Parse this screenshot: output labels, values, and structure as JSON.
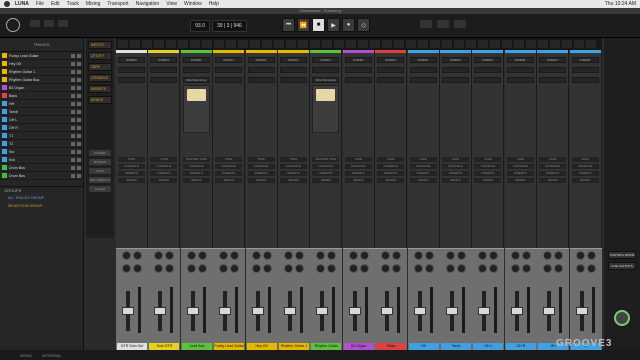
{
  "menubar": {
    "app_name": "LUNA",
    "items": [
      "File",
      "Edit",
      "Track",
      "Mixing",
      "Transport",
      "Navigation",
      "View",
      "Window",
      "Help"
    ],
    "clock": "Thu 10:24 AM"
  },
  "window_title": "Chaosmack - Summing",
  "transport": {
    "tempo": "93.0",
    "position": "39 | 3 | 946"
  },
  "left_panel": {
    "header": "TRACKS",
    "tracks": [
      {
        "name": "Funky Lead Guitar",
        "color": "#e6b800"
      },
      {
        "name": "Hey Oh",
        "color": "#e6b800"
      },
      {
        "name": "Rhythm Guitar 1",
        "color": "#e6b800"
      },
      {
        "name": "Rhythm Guitar Bus",
        "color": "#e6b800"
      },
      {
        "name": "B3 Organ",
        "color": "#b050d0"
      },
      {
        "name": "Bass",
        "color": "#e04040"
      },
      {
        "name": "HH",
        "color": "#40a0e0"
      },
      {
        "name": "Tamb",
        "color": "#40a0e0"
      },
      {
        "name": "OH L",
        "color": "#40a0e0"
      },
      {
        "name": "OH R",
        "color": "#40a0e0"
      },
      {
        "name": "T1",
        "color": "#40a0e0"
      },
      {
        "name": "T2",
        "color": "#40a0e0"
      },
      {
        "name": "Snr",
        "color": "#40a0e0"
      },
      {
        "name": "Kck",
        "color": "#40a0e0"
      },
      {
        "name": "Drum Bus",
        "color": "#40c040"
      },
      {
        "name": "Drum Bus",
        "color": "#40c040"
      }
    ],
    "groups_header": "GROUPS",
    "groups": [
      "ALL TRACKS GROUP",
      "SELECTION GROUP"
    ]
  },
  "inserts_panel": {
    "buttons": [
      "INPUTS",
      "UTILITY",
      "TAPE",
      "CONSOLE",
      "INSERTS",
      "SENDS"
    ],
    "small_buttons": [
      "POWER",
      "BYPASS",
      "COPY",
      "SET DEFAULT",
      "CLEAR"
    ]
  },
  "channels": [
    {
      "name": "GTR Solo Out",
      "color": "#e0e0e0",
      "has_plugin": false
    },
    {
      "name": "Solo GTR",
      "color": "#e6d020",
      "has_plugin": false
    },
    {
      "name": "Lead Bus",
      "color": "#5ec040",
      "has_plugin": true
    },
    {
      "name": "Funky Lead Guitar",
      "color": "#e6b800",
      "has_plugin": false
    },
    {
      "name": "Hey Oh",
      "color": "#e6b800",
      "has_plugin": false
    },
    {
      "name": "Rhythm Guitar 1",
      "color": "#e6b800",
      "has_plugin": false
    },
    {
      "name": "Rhythm Guitar Bus",
      "color": "#5ec040",
      "has_plugin": true
    },
    {
      "name": "B3 Organ",
      "color": "#b050d0",
      "has_plugin": false
    },
    {
      "name": "Bass",
      "color": "#e04040",
      "has_plugin": false
    },
    {
      "name": "HH",
      "color": "#40a0e0",
      "has_plugin": false
    },
    {
      "name": "Tamb",
      "color": "#40a0e0",
      "has_plugin": false
    },
    {
      "name": "OH L",
      "color": "#40a0e0",
      "has_plugin": false
    },
    {
      "name": "OH R",
      "color": "#40a0e0",
      "has_plugin": false
    },
    {
      "name": "HH",
      "color": "#40a0e0",
      "has_plugin": false
    },
    {
      "name": "T2",
      "color": "#40a0e0",
      "has_plugin": false
    }
  ],
  "slot_labels": {
    "insert": "INSERT",
    "tape": "TAPE",
    "console": "CONSOLE",
    "inserts": "INSERTS",
    "sends": "SENDS",
    "plugin": "Mind Summing",
    "plugin_tape": "MASTER TAPE"
  },
  "right_strip": {
    "buttons": [
      "CONTROL ROOM",
      "CUE OUTPUTS"
    ]
  },
  "watermark": "GROOVE3",
  "bottom_bar": [
    "MENU",
    "INTERNAL"
  ]
}
